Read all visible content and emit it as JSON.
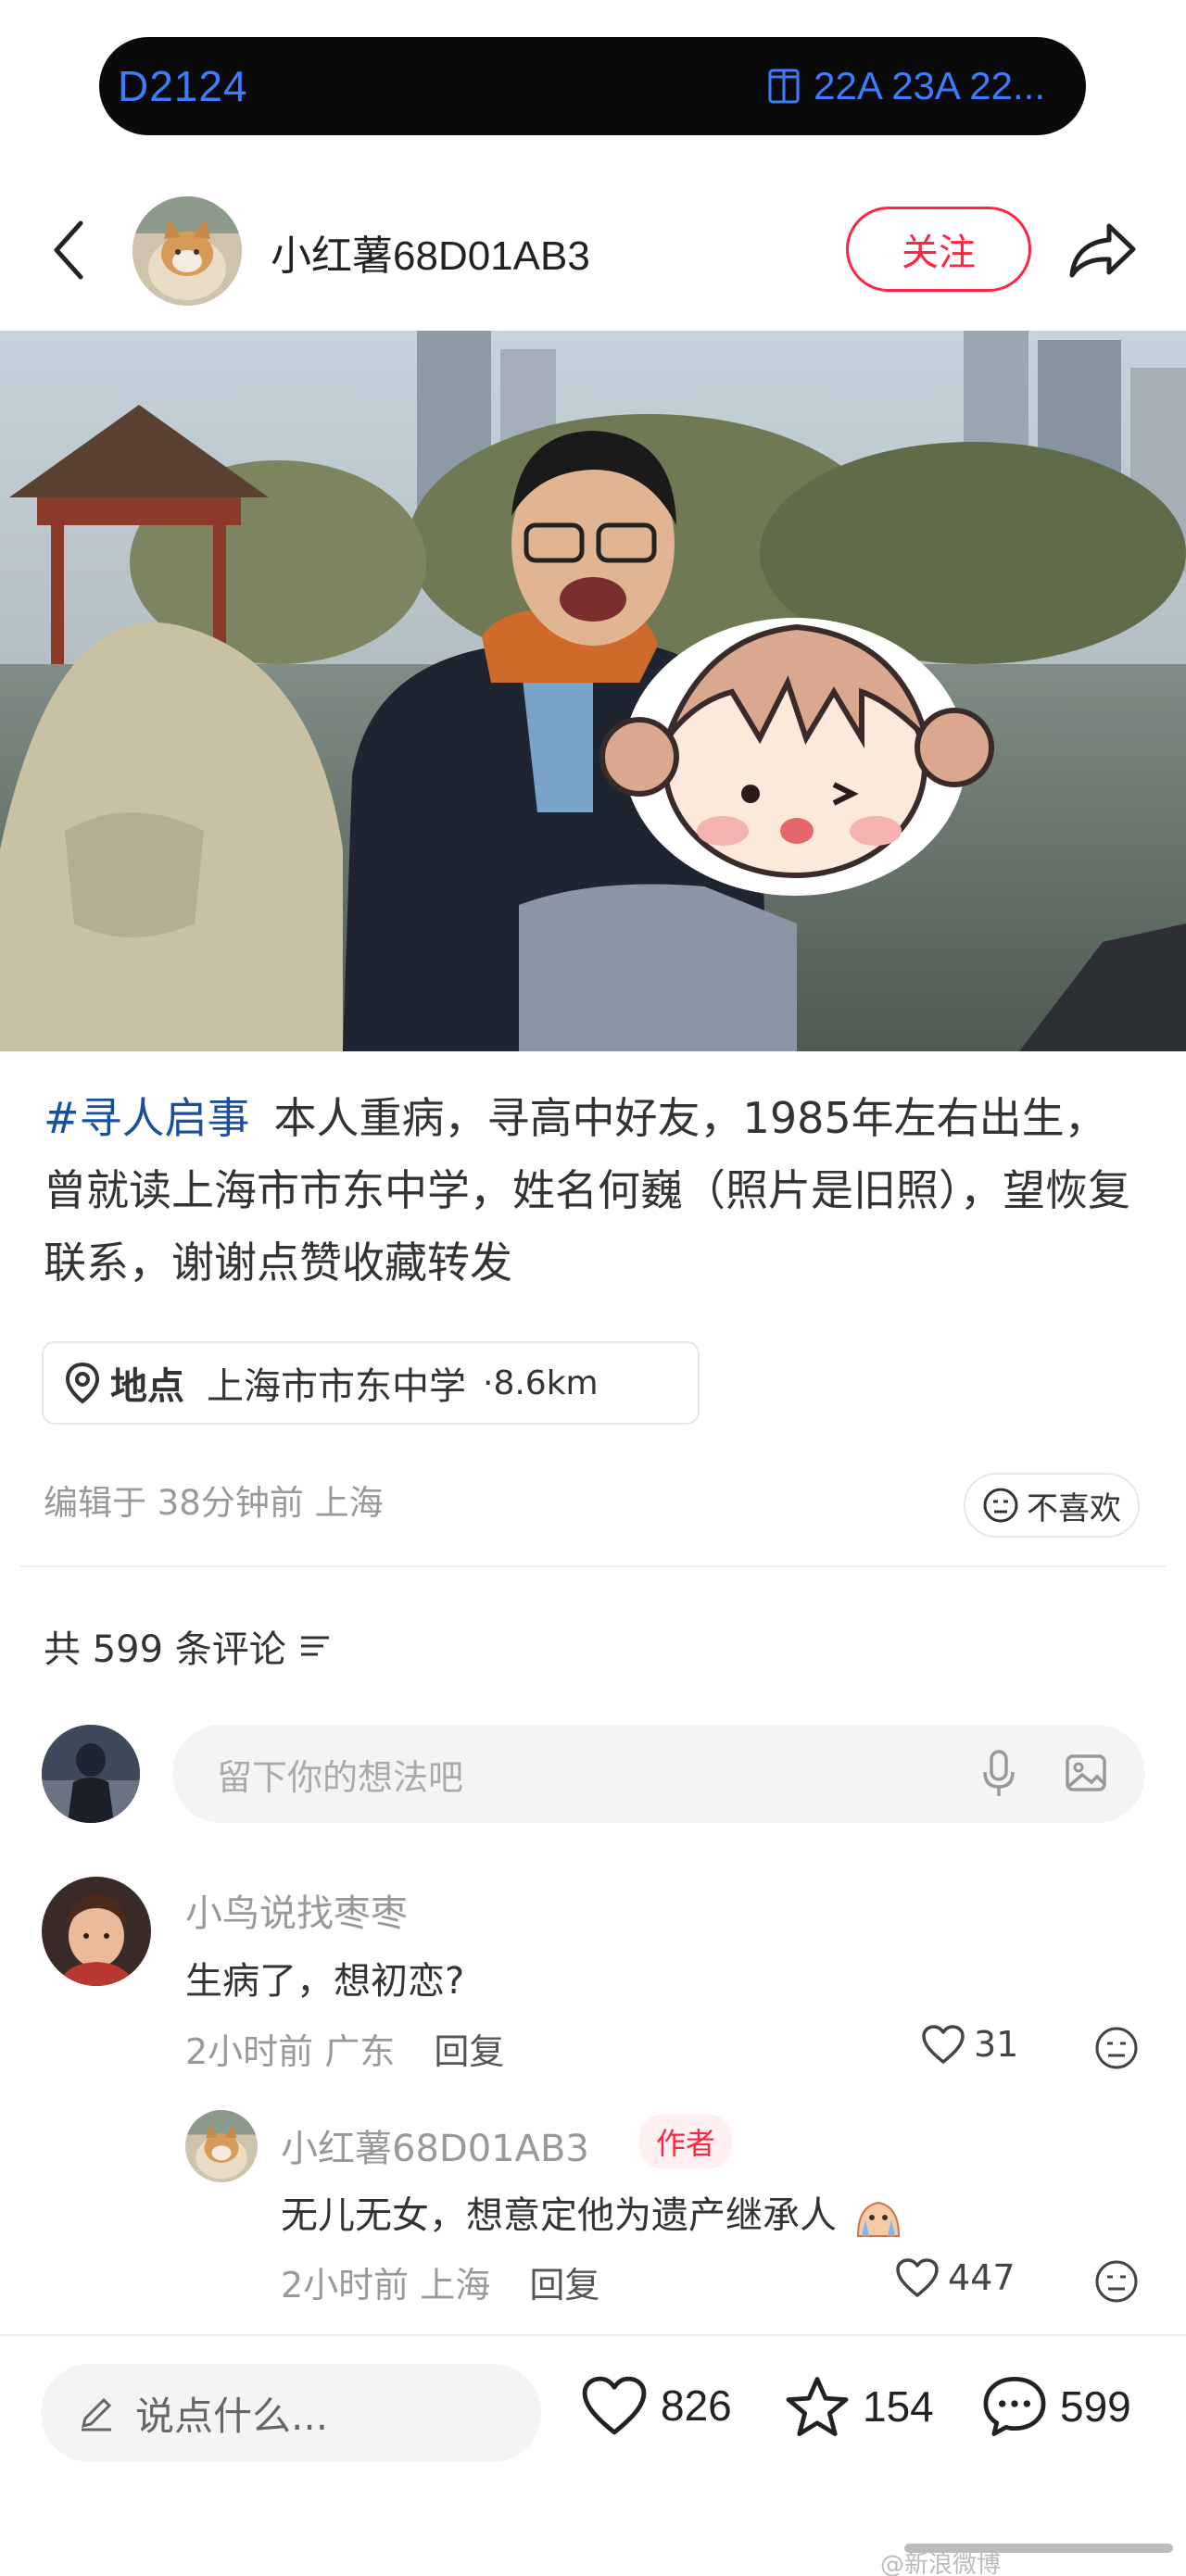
{
  "status_bar": {
    "left_text": "D2124",
    "right_text": "22A 23A 22..."
  },
  "header": {
    "username": "小红薯68D01AB3",
    "follow_label": "关注"
  },
  "post": {
    "hashtag": "#寻人启事",
    "body": "本人重病，寻高中好友，1985年左右出生，曾就读上海市市东中学，姓名何巍（照片是旧照），望恢复联系，谢谢点赞收藏转发",
    "location_label": "地点",
    "location_value": "上海市市东中学",
    "location_distance": "·8.6km",
    "meta": "编辑于 38分钟前 上海",
    "dislike_label": "不喜欢"
  },
  "comments_section": {
    "count_label": "共 599 条评论",
    "input_placeholder": "留下你的想法吧"
  },
  "comments": [
    {
      "name": "小鸟说找枣枣",
      "text": "生病了，想初恋?",
      "time": "2小时前",
      "region": "广东",
      "reply_label": "回复",
      "likes": "31"
    },
    {
      "name": "小红薯68D01AB3",
      "badge": "作者",
      "text": "无儿无女，想意定他为遗产继承人",
      "time": "2小时前",
      "region": "上海",
      "reply_label": "回复",
      "likes": "447"
    }
  ],
  "bottom_bar": {
    "placeholder": "说点什么...",
    "likes": "826",
    "collects": "154",
    "comments": "599"
  },
  "watermark": "@新浪微博",
  "colors": {
    "brand_red": "#ff2442",
    "hashtag_blue": "#1a4f9c",
    "pill_text_blue": "#3d7bff"
  }
}
